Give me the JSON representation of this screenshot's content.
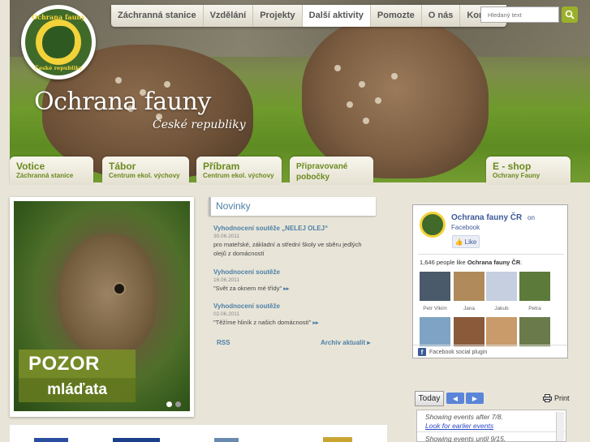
{
  "header": {
    "hero_title": "Ochrana fauny",
    "hero_subtitle": "České republiky",
    "logo_top_text": "Ochrana fauny",
    "logo_bottom_text": "České republiky"
  },
  "nav": {
    "items": [
      {
        "label": "Záchranná stanice"
      },
      {
        "label": "Vzdělání"
      },
      {
        "label": "Projekty"
      },
      {
        "label": "Další aktivity"
      },
      {
        "label": "Pomozte"
      },
      {
        "label": "O nás"
      },
      {
        "label": "Kontakt"
      }
    ],
    "active_index": 3
  },
  "search": {
    "placeholder": "Hledaný text",
    "button_icon": "search-icon"
  },
  "tabs": [
    {
      "title": "Votice",
      "subtitle": "Záchranná stanice"
    },
    {
      "title": "Tábor",
      "subtitle": "Centrum ekol. výchovy"
    },
    {
      "title": "Příbram",
      "subtitle": "Centrum ekol. výchovy"
    },
    {
      "title": "Připravované",
      "subtitle": "pobočky"
    },
    {
      "title": "E - shop",
      "subtitle": "Ochrany Fauny"
    }
  ],
  "promo": {
    "line1": "POZOR",
    "line2": "mláďata"
  },
  "news": {
    "title": "Novinky",
    "items": [
      {
        "headline": "Vyhodnocení soutěže „NELEJ OLEJ“",
        "date": "30.06.2011",
        "text": "pro mateřské, základní a střední školy ve sběru jedlých olejů z domácností"
      },
      {
        "headline": "Vyhodnocení soutěže",
        "date": "16.06.2011",
        "text": "\"Svět za oknem mé třídy\""
      },
      {
        "headline": "Vyhodnocení soutěže",
        "date": "02.06.2011",
        "text": "\"Těžíme hliník z našich domácností\""
      }
    ],
    "more_arrow": "▸▸",
    "rss_label": "RSS",
    "archive_label": "Archiv aktualit"
  },
  "facebook": {
    "page_name": "Ochrana fauny ČR",
    "on_label": "on",
    "network": "Facebook",
    "like_label": "Like",
    "count_prefix": "1,646 people like",
    "count_name": "Ochrana fauny ČR",
    "fans": [
      {
        "name": "Petr Vlkim",
        "color": "#4a5a6a"
      },
      {
        "name": "Jana",
        "color": "#b08a5a"
      },
      {
        "name": "Jakub",
        "color": "#c6cfe0"
      },
      {
        "name": "Petra",
        "color": "#5c7a3a"
      },
      {
        "name": "",
        "color": "#7fa3c4"
      },
      {
        "name": "",
        "color": "#8a5a3a"
      },
      {
        "name": "",
        "color": "#c99a6a"
      },
      {
        "name": "",
        "color": "#6a7a4a"
      }
    ],
    "footer": "Facebook social plugin"
  },
  "calendar": {
    "today_label": "Today",
    "print_label": "Print",
    "prev_icon": "◀",
    "next_icon": "▶",
    "showing_after": "Showing events after 7/8.",
    "earlier_link": "Look for earlier events",
    "showing_until": "Showing events until 9/15."
  },
  "colors": {
    "accent_green": "#6b8a1f",
    "link_blue": "#4d7fa6",
    "fb_blue": "#3b5998",
    "page_bg": "#e8e5d8"
  }
}
